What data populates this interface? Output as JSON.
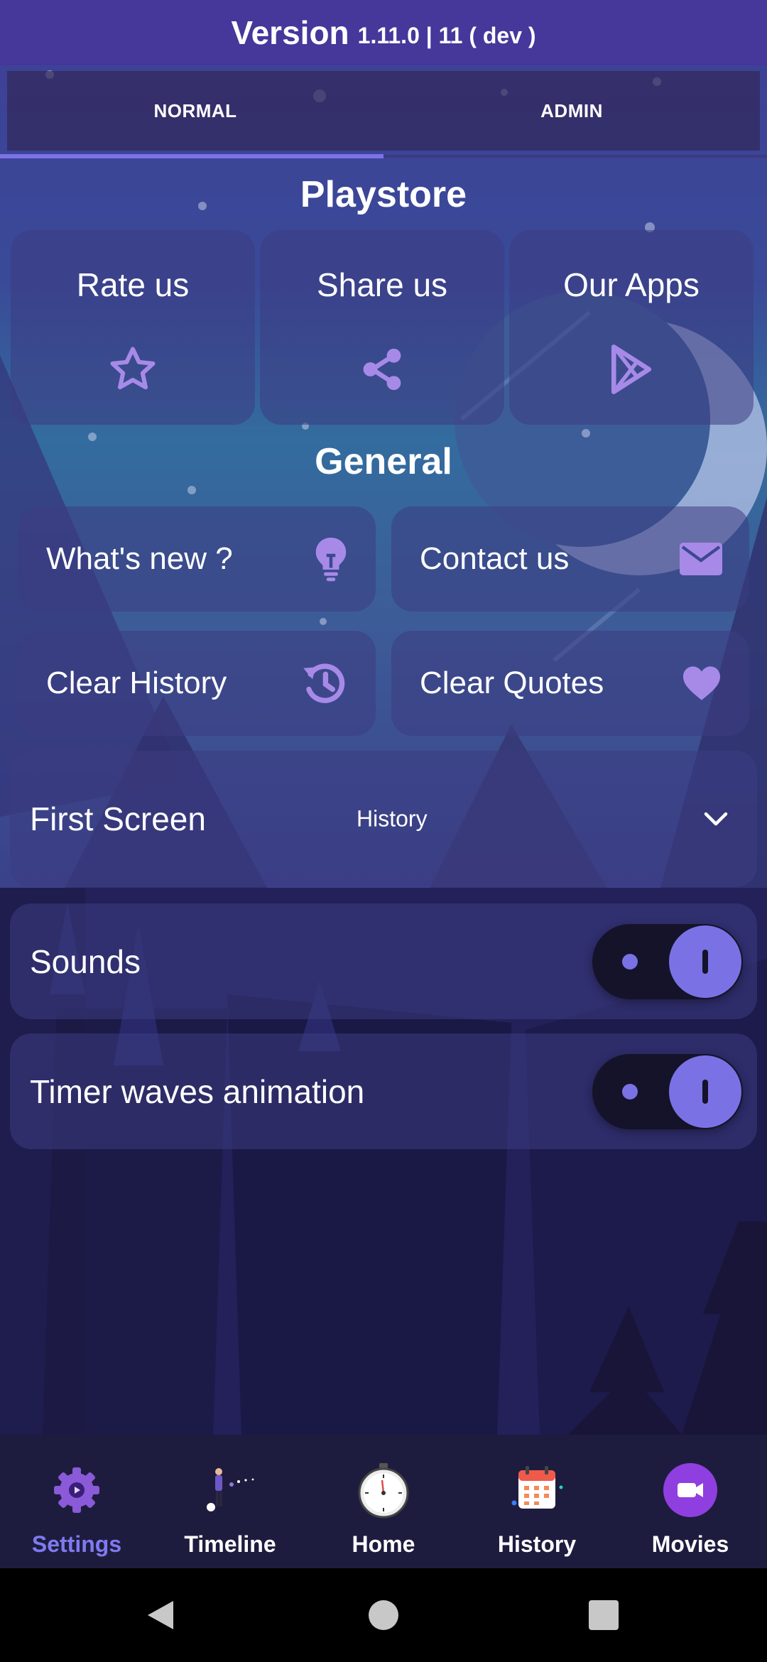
{
  "version": {
    "label": "Version",
    "value": "1.11.0 | 11 ( dev )"
  },
  "tabs": [
    {
      "label": "NORMAL",
      "active": true
    },
    {
      "label": "ADMIN",
      "active": false
    }
  ],
  "playstore": {
    "title": "Playstore",
    "items": [
      {
        "label": "Rate us",
        "icon": "star-icon"
      },
      {
        "label": "Share us",
        "icon": "share-icon"
      },
      {
        "label": "Our Apps",
        "icon": "play-store-icon"
      }
    ]
  },
  "general": {
    "title": "General",
    "items": [
      {
        "label": "What's new ?",
        "icon": "lightbulb-icon"
      },
      {
        "label": "Contact us",
        "icon": "mail-icon"
      },
      {
        "label": "Clear History",
        "icon": "history-icon"
      },
      {
        "label": "Clear Quotes",
        "icon": "heart-icon"
      }
    ]
  },
  "first_screen": {
    "label": "First Screen",
    "value": "History"
  },
  "sounds": {
    "label": "Sounds",
    "on": true
  },
  "timer_waves": {
    "label": "Timer waves animation",
    "on": true
  },
  "bottom_nav": [
    {
      "label": "Settings",
      "icon": "gear-icon",
      "active": true
    },
    {
      "label": "Timeline",
      "icon": "timeline-icon",
      "active": false
    },
    {
      "label": "Home",
      "icon": "stopwatch-icon",
      "active": false
    },
    {
      "label": "History",
      "icon": "calendar-icon",
      "active": false
    },
    {
      "label": "Movies",
      "icon": "video-camera-icon",
      "active": false
    }
  ],
  "colors": {
    "accent": "#7d72e6",
    "header": "#46379b",
    "nav_bar": "#1e1c3e",
    "icon_purple": "#a78ae8"
  }
}
